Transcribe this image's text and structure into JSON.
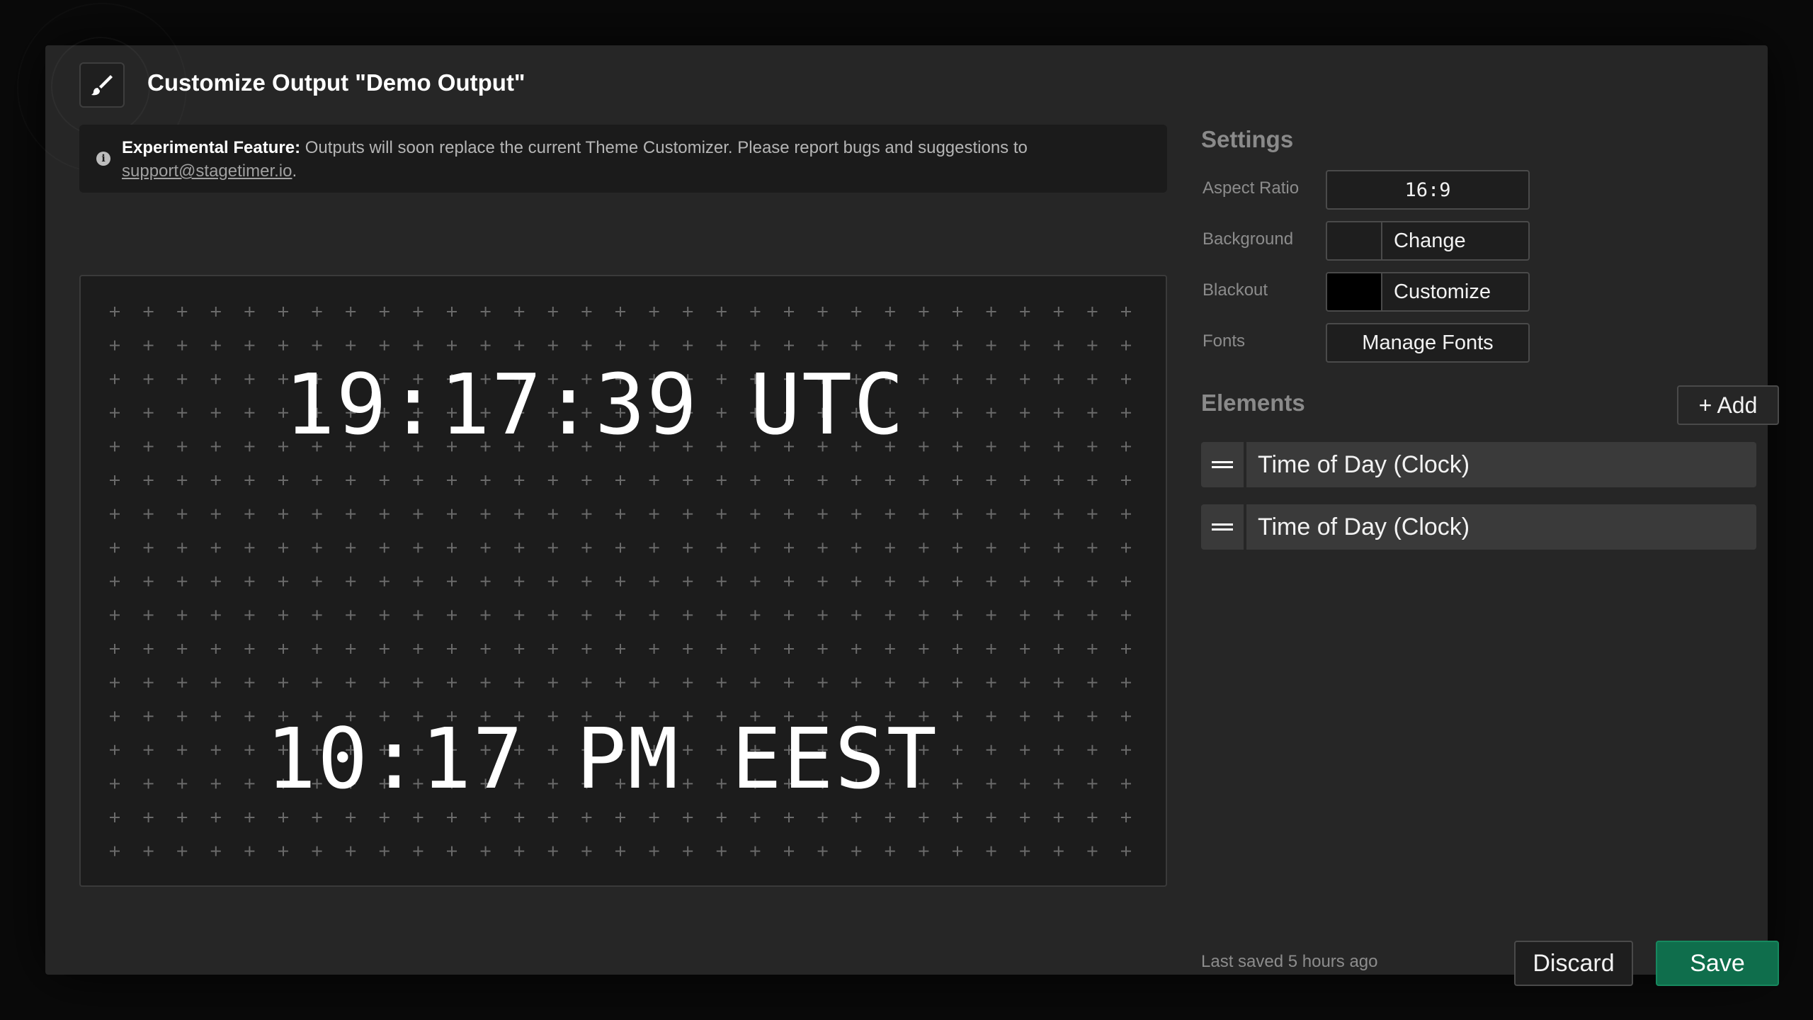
{
  "header": {
    "title": "Customize Output \"Demo Output\"",
    "icon": "paintbrush-icon"
  },
  "banner": {
    "label": "Experimental Feature:",
    "message": " Outputs will soon replace the current Theme Customizer. Please report bugs and suggestions to ",
    "link": "support@stagetimer.io",
    "suffix": "."
  },
  "preview": {
    "clock_1": "19:17:39 UTC",
    "clock_2": "10:17 PM EEST"
  },
  "settings": {
    "title": "Settings",
    "aspect_ratio_label": "Aspect Ratio",
    "aspect_ratio_value": "16:9",
    "background_label": "Background",
    "background_button": "Change",
    "background_color": "#1e1e1e",
    "blackout_label": "Blackout",
    "blackout_button": "Customize",
    "blackout_color": "#000000",
    "fonts_label": "Fonts",
    "fonts_button": "Manage Fonts"
  },
  "elements": {
    "title": "Elements",
    "add_button": "+ Add",
    "items": [
      {
        "label": "Time of Day (Clock)"
      },
      {
        "label": "Time of Day (Clock)"
      }
    ]
  },
  "footer": {
    "last_saved": "Last saved 5 hours ago",
    "discard": "Discard",
    "save": "Save"
  },
  "colors": {
    "accent": "#0f6e4c",
    "panel": "#262626",
    "preview_bg": "#1c1c1c"
  }
}
